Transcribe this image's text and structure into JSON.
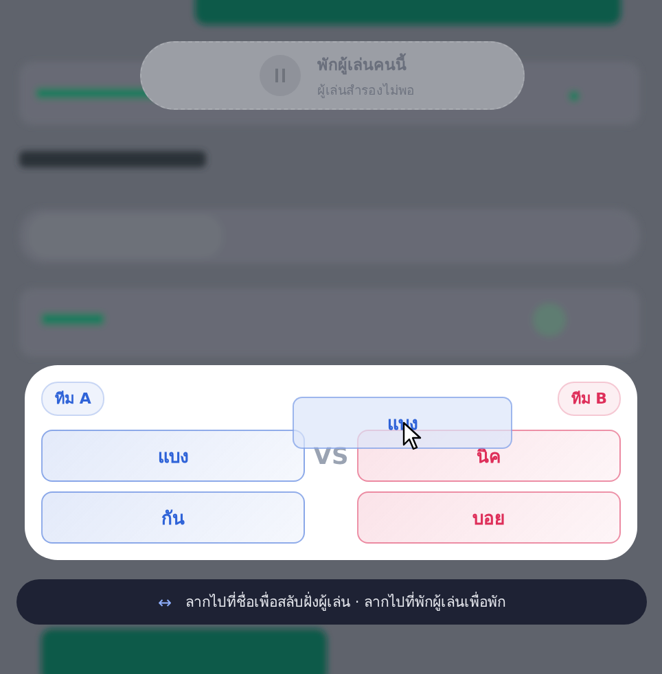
{
  "pause_zone": {
    "title": "พักผู้เล่นคนนี้",
    "subtitle": "ผู้เล่นสำรองไม่พอ"
  },
  "teams": [
    {
      "label": "ทีม A",
      "color": "#2f63d8",
      "players": [
        "แบง",
        "กัน"
      ]
    },
    {
      "label": "ทีม B",
      "color": "#de2f5a",
      "players": [
        "นิค",
        "บอย"
      ]
    }
  ],
  "versus": "VS",
  "dragging": {
    "name": "แบง"
  },
  "hint": {
    "icon": "↔",
    "text": "ลากไปที่ชื่อเพื่อสลับฝั่งผู้เล่น · ลากไปที่พักผู้เล่นเพื่อพัก"
  }
}
